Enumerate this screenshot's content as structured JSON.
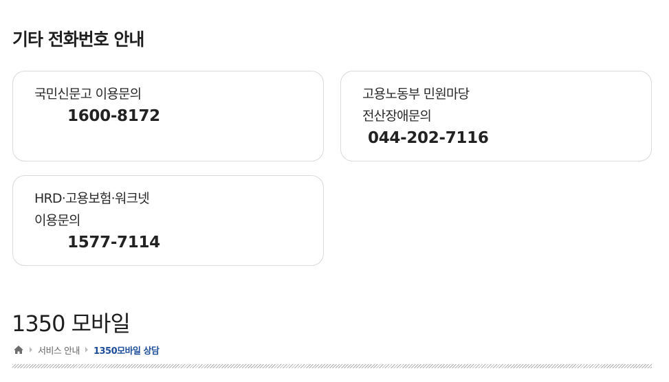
{
  "section": {
    "title": "기타 전화번호 안내"
  },
  "cards": [
    {
      "label_lines": [
        "국민신문고 이용문의"
      ],
      "number": "1600-8172"
    },
    {
      "label_lines": [
        "고용노동부 민원마당",
        "전산장애문의"
      ],
      "number": "044-202-7116"
    },
    {
      "label_lines": [
        "HRD·고용보험·워크넷",
        "이용문의"
      ],
      "number": "1577-7114"
    }
  ],
  "page": {
    "heading": "1350 모바일"
  },
  "breadcrumb": {
    "home_icon": "home-icon",
    "items": [
      "서비스 안내",
      "1350모바일 상담"
    ]
  },
  "colors": {
    "breadcrumb_current": "#1d4d9a",
    "card_border": "#d9d9d9"
  }
}
